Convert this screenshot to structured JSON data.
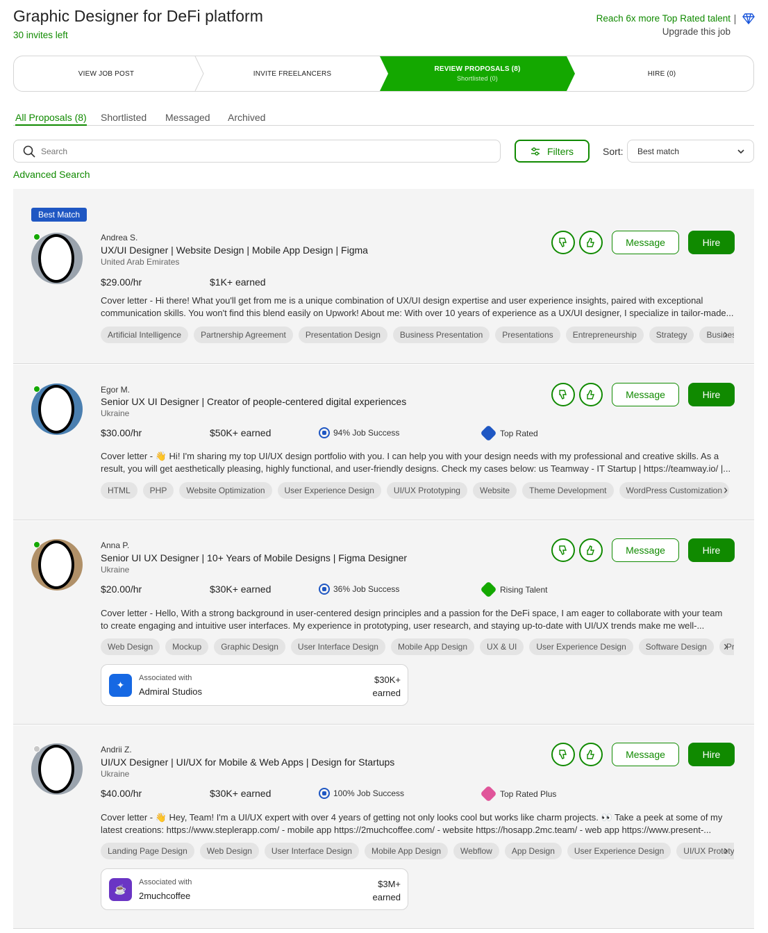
{
  "header": {
    "job_title": "Graphic Designer for DeFi platform",
    "invites_left": "30 invites left",
    "reach_text": "Reach 6x more Top Rated talent",
    "upgrade_text": "Upgrade this job",
    "gem_icon": "diamond-icon"
  },
  "steps": [
    {
      "label": "VIEW JOB POST"
    },
    {
      "label": "INVITE FREELANCERS"
    },
    {
      "label": "REVIEW PROPOSALS (8)",
      "sub": "Shortlisted (0)"
    },
    {
      "label": "HIRE (0)"
    }
  ],
  "tabs": [
    "All Proposals (8)",
    "Shortlisted",
    "Messaged",
    "Archived"
  ],
  "search": {
    "placeholder": "Search"
  },
  "filters_label": "Filters",
  "sort": {
    "label": "Sort:",
    "value": "Best match"
  },
  "advanced_search": "Advanced Search",
  "actions": {
    "message": "Message",
    "hire": "Hire"
  },
  "best_match_label": "Best Match",
  "proposals": [
    {
      "name": "Andrea S.",
      "title": "UX/UI Designer | Website Design | Mobile App Design | Figma",
      "country": "United Arab Emirates",
      "rate": "$29.00/hr",
      "earned": "$1K+ earned",
      "cover_line1": "Cover letter - Hi there! What you'll get from me is a unique combination of UX/UI design expertise and user experience insights, paired with exceptional",
      "cover_line2": "communication skills. You won't find this blend easily on Upwork! About me: With over 10 years of experience as a UX/UI designer, I specialize in tailor-made...",
      "skills": [
        "Artificial Intelligence",
        "Partnership Agreement",
        "Presentation Design",
        "Business Presentation",
        "Presentations",
        "Entrepreneurship",
        "Strategy",
        "Business"
      ]
    },
    {
      "name": "Egor M.",
      "title": "Senior UX UI Designer | Creator of people-centered digital experiences",
      "country": "Ukraine",
      "rate": "$30.00/hr",
      "earned": "$50K+ earned",
      "jss": "94% Job Success",
      "badge": "Top Rated",
      "badge_color": "#1f57c3",
      "cover_line1": "Cover letter - 👋 Hi! I'm sharing my top UI/UX design portfolio with you. I can help you with your design needs with my professional and creative skills. As a",
      "cover_line2": "result, you will get aesthetically pleasing, highly functional, and user-friendly designs. Check my cases below: us Teamway - IT Startup | https://teamway.io/ |...",
      "skills": [
        "HTML",
        "PHP",
        "Website Optimization",
        "User Experience Design",
        "UI/UX Prototyping",
        "Website",
        "Theme Development",
        "WordPress Customization"
      ]
    },
    {
      "name": "Anna P.",
      "title": "Senior UI UX Designer | 10+ Years of Mobile Designs | Figma Designer",
      "country": "Ukraine",
      "rate": "$20.00/hr",
      "earned": "$30K+ earned",
      "jss": "36% Job Success",
      "badge": "Rising Talent",
      "badge_color": "#14a800",
      "cover_line1": "Cover letter - Hello, With a strong background in user-centered design principles and a passion for the DeFi space, I am eager to collaborate with your team",
      "cover_line2": "to create engaging and intuitive user interfaces. My experience in prototyping, user research, and staying up-to-date with UI/UX trends make me well-...",
      "skills": [
        "Web Design",
        "Mockup",
        "Graphic Design",
        "User Interface Design",
        "Mobile App Design",
        "UX & UI",
        "User Experience Design",
        "Software Design",
        "Prototyping"
      ],
      "assoc": {
        "label": "Associated with",
        "agency": "Admiral Studios",
        "amount1": "$30K+",
        "amount2": "earned",
        "color": "#1668e3"
      }
    },
    {
      "name": "Andrii Z.",
      "title": "UI/UX Designer | UI/UX for Mobile & Web Apps | Design for Startups",
      "country": "Ukraine",
      "rate": "$40.00/hr",
      "earned": "$30K+ earned",
      "jss": "100% Job Success",
      "badge": "Top Rated Plus",
      "badge_color": "#e0559a",
      "cover_line1": "Cover letter - 👋 Hey, Team! I'm a UI/UX expert with over 4 years of getting not only looks cool but works like charm projects. 👀 Take a peek at some of my",
      "cover_line2": "latest creations: https://www.steplerapp.com/ - mobile app https://2muchcoffee.com/ - website https://hosapp.2mc.team/ - web app https://www.present-...",
      "skills": [
        "Landing Page Design",
        "Web Design",
        "User Interface Design",
        "Mobile App Design",
        "Webflow",
        "App Design",
        "User Experience Design",
        "UI/UX Prototyping"
      ],
      "assoc": {
        "label": "Associated with",
        "agency": "2muchcoffee",
        "amount1": "$3M+",
        "amount2": "earned",
        "color": "#6a35c4"
      }
    }
  ]
}
